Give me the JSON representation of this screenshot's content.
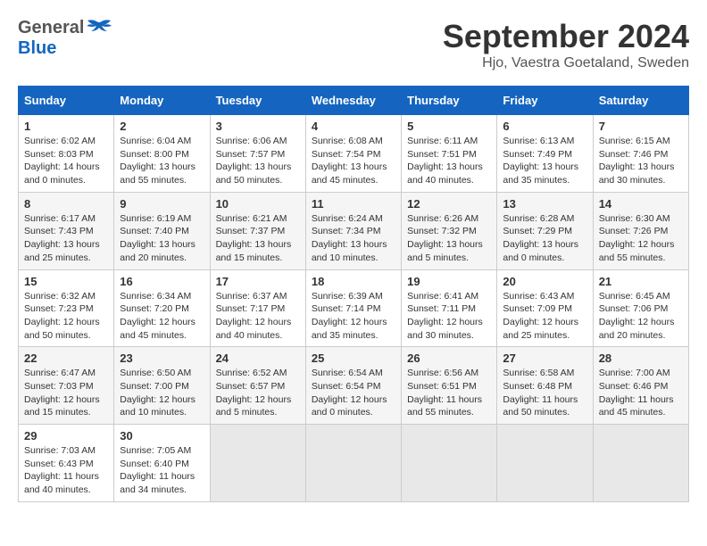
{
  "header": {
    "logo_general": "General",
    "logo_blue": "Blue",
    "month_title": "September 2024",
    "subtitle": "Hjo, Vaestra Goetaland, Sweden"
  },
  "weekdays": [
    "Sunday",
    "Monday",
    "Tuesday",
    "Wednesday",
    "Thursday",
    "Friday",
    "Saturday"
  ],
  "weeks": [
    [
      {
        "day": "1",
        "sunrise": "6:02 AM",
        "sunset": "8:03 PM",
        "daylight": "14 hours and 0 minutes."
      },
      {
        "day": "2",
        "sunrise": "6:04 AM",
        "sunset": "8:00 PM",
        "daylight": "13 hours and 55 minutes."
      },
      {
        "day": "3",
        "sunrise": "6:06 AM",
        "sunset": "7:57 PM",
        "daylight": "13 hours and 50 minutes."
      },
      {
        "day": "4",
        "sunrise": "6:08 AM",
        "sunset": "7:54 PM",
        "daylight": "13 hours and 45 minutes."
      },
      {
        "day": "5",
        "sunrise": "6:11 AM",
        "sunset": "7:51 PM",
        "daylight": "13 hours and 40 minutes."
      },
      {
        "day": "6",
        "sunrise": "6:13 AM",
        "sunset": "7:49 PM",
        "daylight": "13 hours and 35 minutes."
      },
      {
        "day": "7",
        "sunrise": "6:15 AM",
        "sunset": "7:46 PM",
        "daylight": "13 hours and 30 minutes."
      }
    ],
    [
      {
        "day": "8",
        "sunrise": "6:17 AM",
        "sunset": "7:43 PM",
        "daylight": "13 hours and 25 minutes."
      },
      {
        "day": "9",
        "sunrise": "6:19 AM",
        "sunset": "7:40 PM",
        "daylight": "13 hours and 20 minutes."
      },
      {
        "day": "10",
        "sunrise": "6:21 AM",
        "sunset": "7:37 PM",
        "daylight": "13 hours and 15 minutes."
      },
      {
        "day": "11",
        "sunrise": "6:24 AM",
        "sunset": "7:34 PM",
        "daylight": "13 hours and 10 minutes."
      },
      {
        "day": "12",
        "sunrise": "6:26 AM",
        "sunset": "7:32 PM",
        "daylight": "13 hours and 5 minutes."
      },
      {
        "day": "13",
        "sunrise": "6:28 AM",
        "sunset": "7:29 PM",
        "daylight": "13 hours and 0 minutes."
      },
      {
        "day": "14",
        "sunrise": "6:30 AM",
        "sunset": "7:26 PM",
        "daylight": "12 hours and 55 minutes."
      }
    ],
    [
      {
        "day": "15",
        "sunrise": "6:32 AM",
        "sunset": "7:23 PM",
        "daylight": "12 hours and 50 minutes."
      },
      {
        "day": "16",
        "sunrise": "6:34 AM",
        "sunset": "7:20 PM",
        "daylight": "12 hours and 45 minutes."
      },
      {
        "day": "17",
        "sunrise": "6:37 AM",
        "sunset": "7:17 PM",
        "daylight": "12 hours and 40 minutes."
      },
      {
        "day": "18",
        "sunrise": "6:39 AM",
        "sunset": "7:14 PM",
        "daylight": "12 hours and 35 minutes."
      },
      {
        "day": "19",
        "sunrise": "6:41 AM",
        "sunset": "7:11 PM",
        "daylight": "12 hours and 30 minutes."
      },
      {
        "day": "20",
        "sunrise": "6:43 AM",
        "sunset": "7:09 PM",
        "daylight": "12 hours and 25 minutes."
      },
      {
        "day": "21",
        "sunrise": "6:45 AM",
        "sunset": "7:06 PM",
        "daylight": "12 hours and 20 minutes."
      }
    ],
    [
      {
        "day": "22",
        "sunrise": "6:47 AM",
        "sunset": "7:03 PM",
        "daylight": "12 hours and 15 minutes."
      },
      {
        "day": "23",
        "sunrise": "6:50 AM",
        "sunset": "7:00 PM",
        "daylight": "12 hours and 10 minutes."
      },
      {
        "day": "24",
        "sunrise": "6:52 AM",
        "sunset": "6:57 PM",
        "daylight": "12 hours and 5 minutes."
      },
      {
        "day": "25",
        "sunrise": "6:54 AM",
        "sunset": "6:54 PM",
        "daylight": "12 hours and 0 minutes."
      },
      {
        "day": "26",
        "sunrise": "6:56 AM",
        "sunset": "6:51 PM",
        "daylight": "11 hours and 55 minutes."
      },
      {
        "day": "27",
        "sunrise": "6:58 AM",
        "sunset": "6:48 PM",
        "daylight": "11 hours and 50 minutes."
      },
      {
        "day": "28",
        "sunrise": "7:00 AM",
        "sunset": "6:46 PM",
        "daylight": "11 hours and 45 minutes."
      }
    ],
    [
      {
        "day": "29",
        "sunrise": "7:03 AM",
        "sunset": "6:43 PM",
        "daylight": "11 hours and 40 minutes."
      },
      {
        "day": "30",
        "sunrise": "7:05 AM",
        "sunset": "6:40 PM",
        "daylight": "11 hours and 34 minutes."
      },
      null,
      null,
      null,
      null,
      null
    ]
  ]
}
